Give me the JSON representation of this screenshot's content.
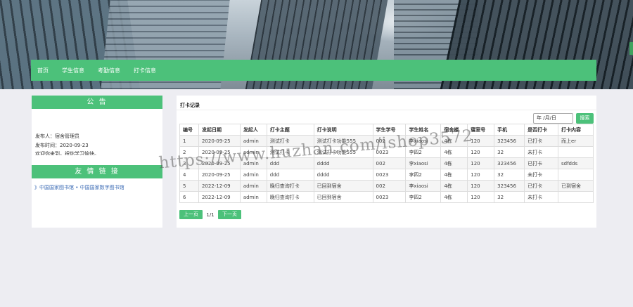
{
  "nav": {
    "items": [
      "首页",
      "学生信息",
      "考勤信息",
      "打卡信息"
    ]
  },
  "notice": {
    "title": "公 告",
    "publisher": "发布人：宿舍管理员",
    "publish_time": "发布时间：2020-09-23",
    "content": "欢迎你来到，祝你学习愉快。"
  },
  "links": {
    "title": "友 情 链 接",
    "text": "》中国国家图书馆 • 中国国家数字图书馆"
  },
  "records": {
    "title": "打卡记录",
    "date_placeholder": "年 /月/日",
    "search_label": "搜索",
    "columns": [
      "编号",
      "发起日期",
      "发起人",
      "打卡主题",
      "打卡说明",
      "学生学号",
      "学生姓名",
      "宿舍楼",
      "寝室号",
      "手机",
      "是否打卡",
      "打卡内容"
    ],
    "rows": [
      [
        "1",
        "2020-09-25",
        "admin",
        "测试打卡",
        "测试打卡功能555",
        "002",
        "李xiaosi",
        "4栋",
        "120",
        "323456",
        "已打卡",
        "而上er"
      ],
      [
        "2",
        "2020-09-25",
        "admin",
        "测试打卡",
        "测试打卡功能555",
        "0023",
        "李四2",
        "4栋",
        "120",
        "32",
        "未打卡",
        ""
      ],
      [
        "3",
        "2020-09-25",
        "admin",
        "ddd",
        "dddd",
        "002",
        "李xiaosi",
        "4栋",
        "120",
        "323456",
        "已打卡",
        "sdfdds"
      ],
      [
        "4",
        "2020-09-25",
        "admin",
        "ddd",
        "dddd",
        "0023",
        "李四2",
        "4栋",
        "120",
        "32",
        "未打卡",
        ""
      ],
      [
        "5",
        "2022-12-09",
        "admin",
        "晚归查询打卡",
        "已回到宿舍",
        "002",
        "李xiaosi",
        "4栋",
        "120",
        "323456",
        "已打卡",
        "已到宿舍"
      ],
      [
        "6",
        "2022-12-09",
        "admin",
        "晚归查询打卡",
        "已回到宿舍",
        "0023",
        "李四2",
        "4栋",
        "120",
        "32",
        "未打卡",
        ""
      ]
    ]
  },
  "pager": {
    "prev": "上一页",
    "page": "1/1",
    "next": "下一页"
  },
  "watermark": "https://www.huzhan.com/ishop3572",
  "colors": {
    "accent": "#4cc17a"
  }
}
